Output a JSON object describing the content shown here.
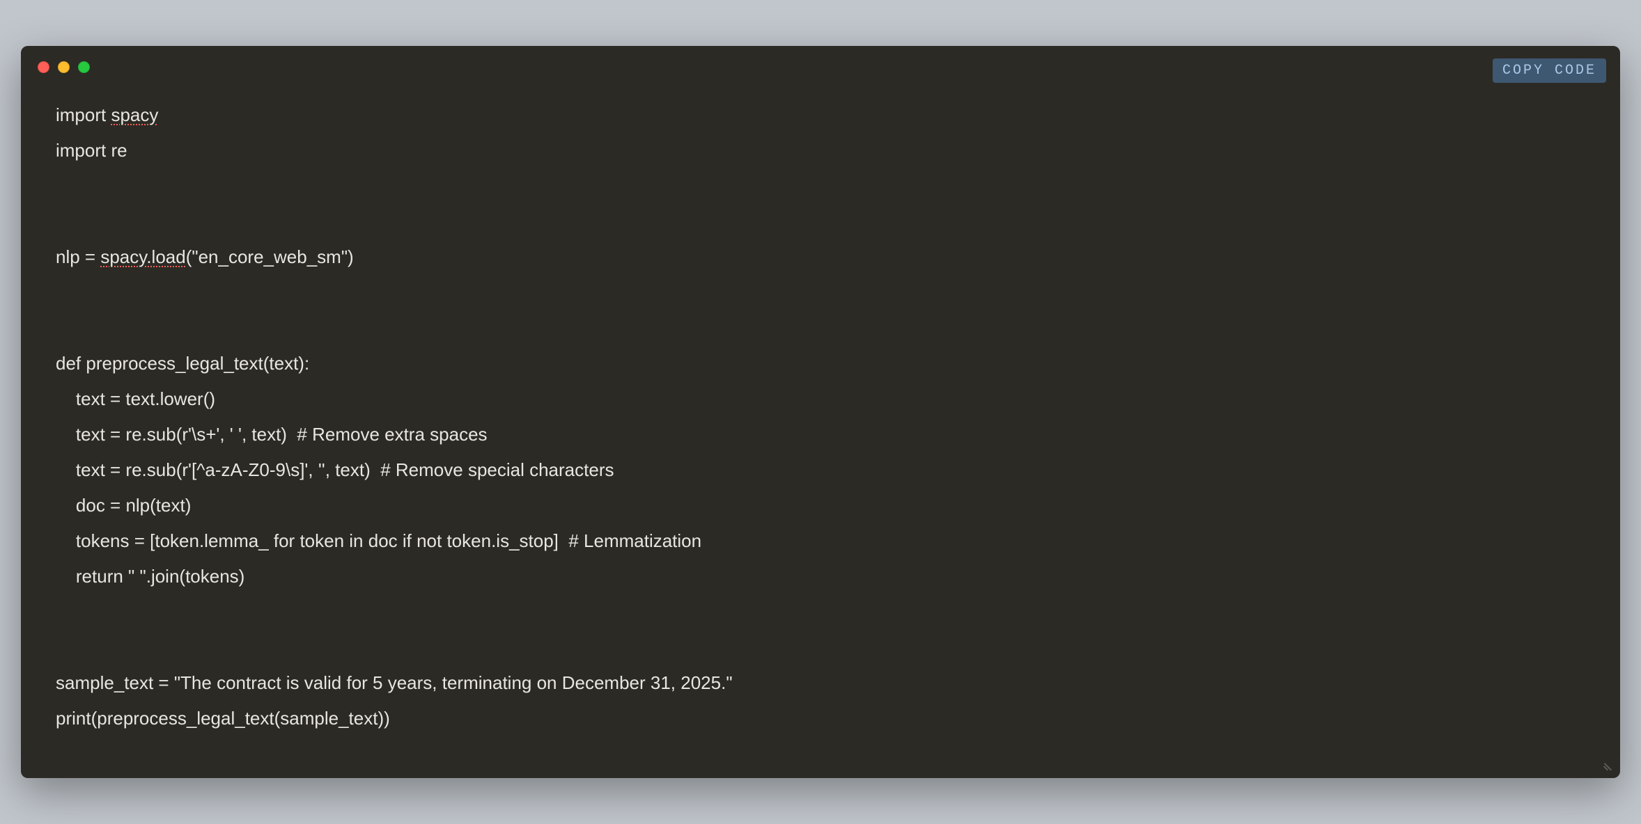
{
  "copy_button_label": "COPY CODE",
  "code": {
    "lines": [
      {
        "segments": [
          {
            "t": "import ",
            "cls": ""
          },
          {
            "t": "spacy",
            "cls": "squiggle"
          }
        ]
      },
      {
        "segments": [
          {
            "t": "import re",
            "cls": ""
          }
        ]
      },
      {
        "segments": [
          {
            "t": "",
            "cls": ""
          }
        ]
      },
      {
        "segments": [
          {
            "t": "",
            "cls": ""
          }
        ]
      },
      {
        "segments": [
          {
            "t": "nlp = ",
            "cls": ""
          },
          {
            "t": "spacy.load",
            "cls": "squiggle"
          },
          {
            "t": "(\"en_core_web_sm\")",
            "cls": ""
          }
        ]
      },
      {
        "segments": [
          {
            "t": "",
            "cls": ""
          }
        ]
      },
      {
        "segments": [
          {
            "t": "",
            "cls": ""
          }
        ]
      },
      {
        "segments": [
          {
            "t": "def preprocess_legal_text(text):",
            "cls": ""
          }
        ]
      },
      {
        "segments": [
          {
            "t": "    text = text.lower()",
            "cls": ""
          }
        ]
      },
      {
        "segments": [
          {
            "t": "    text = re.sub(r'\\s+', ' ', text)  # Remove extra spaces",
            "cls": ""
          }
        ]
      },
      {
        "segments": [
          {
            "t": "    text = re.sub(r'[^a-zA-Z0-9\\s]', '', text)  # Remove special characters",
            "cls": ""
          }
        ]
      },
      {
        "segments": [
          {
            "t": "    doc = nlp(text)",
            "cls": ""
          }
        ]
      },
      {
        "segments": [
          {
            "t": "    tokens = [token.lemma_ for token in doc if not token.is_stop]  # Lemmatization",
            "cls": ""
          }
        ]
      },
      {
        "segments": [
          {
            "t": "    return \" \".join(tokens)",
            "cls": ""
          }
        ]
      },
      {
        "segments": [
          {
            "t": "",
            "cls": ""
          }
        ]
      },
      {
        "segments": [
          {
            "t": "",
            "cls": ""
          }
        ]
      },
      {
        "segments": [
          {
            "t": "sample_text = \"The contract is valid for 5 years, terminating on December 31, 2025.\"",
            "cls": ""
          }
        ]
      },
      {
        "segments": [
          {
            "t": "print(preprocess_legal_text(sample_text))",
            "cls": ""
          }
        ]
      }
    ]
  }
}
